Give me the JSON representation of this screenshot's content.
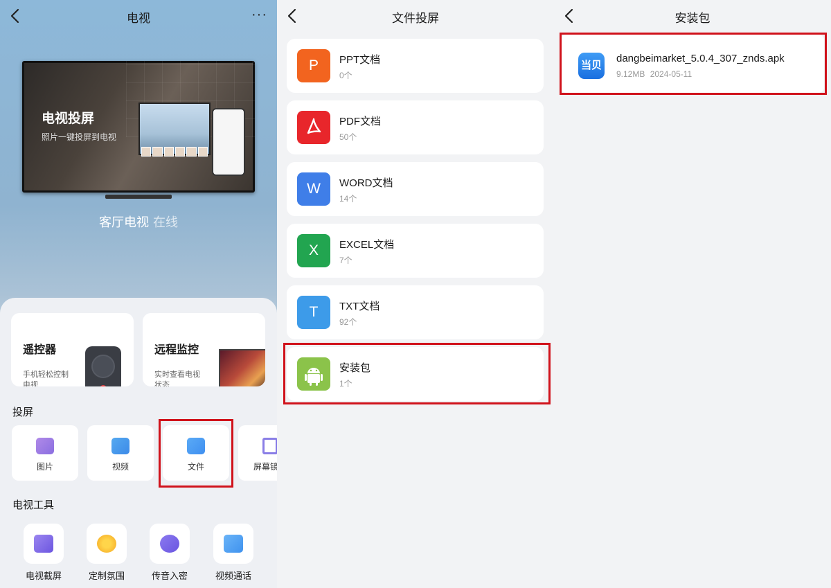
{
  "panel1": {
    "title": "电视",
    "more": "···",
    "banner": {
      "heading": "电视投屏",
      "subtitle": "照片一键投屏到电视"
    },
    "device": {
      "name": "客厅电视",
      "status": "在线"
    },
    "cards": [
      {
        "title": "遥控器",
        "desc": "手机轻松控制电视"
      },
      {
        "title": "远程监控",
        "desc": "实时查看电视状态"
      }
    ],
    "cast_section": "投屏",
    "cast_items": [
      {
        "label": "图片",
        "icon": "image-icon"
      },
      {
        "label": "视频",
        "icon": "video-play-icon"
      },
      {
        "label": "文件",
        "icon": "folder-icon"
      },
      {
        "label": "屏幕镜",
        "icon": "screen-mirror-icon"
      }
    ],
    "tools_section": "电视工具",
    "tools": [
      {
        "label": "电视截屏",
        "icon": "screenshot-icon"
      },
      {
        "label": "定制氛围",
        "icon": "sparkle-icon"
      },
      {
        "label": "传音入密",
        "icon": "voice-icon"
      },
      {
        "label": "视频通话",
        "icon": "video-call-icon"
      }
    ]
  },
  "panel2": {
    "title": "文件投屏",
    "files": [
      {
        "icon_text": "P",
        "name": "PPT文档",
        "count": "0个",
        "color": "#f2641f"
      },
      {
        "icon_text": "",
        "name": "PDF文档",
        "count": "50个",
        "color": "#e8262b"
      },
      {
        "icon_text": "W",
        "name": "WORD文档",
        "count": "14个",
        "color": "#3f7ee8"
      },
      {
        "icon_text": "X",
        "name": "EXCEL文档",
        "count": "7个",
        "color": "#22a550"
      },
      {
        "icon_text": "T",
        "name": "TXT文档",
        "count": "92个",
        "color": "#3d9be9"
      },
      {
        "icon_text": "",
        "name": "安装包",
        "count": "1个",
        "color": "#8bc34a"
      }
    ]
  },
  "panel3": {
    "title": "安装包",
    "apk": {
      "icon_text": "当贝",
      "name": "dangbeimarket_5.0.4_307_znds.apk",
      "size": "9.12MB",
      "date": "2024-05-11"
    }
  },
  "highlight_color": "#d0121b"
}
